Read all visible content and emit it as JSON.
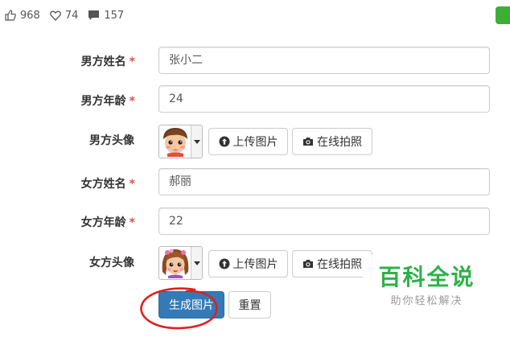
{
  "stats": {
    "likes": "968",
    "favorites": "74",
    "comments": "157"
  },
  "form": {
    "male_name": {
      "label": "男方姓名",
      "required_mark": "*",
      "value": "张小二"
    },
    "male_age": {
      "label": "男方年龄",
      "required_mark": "*",
      "value": "24"
    },
    "male_avatar": {
      "label": "男方头像",
      "upload_label": "上传图片",
      "photo_label": "在线拍照"
    },
    "female_name": {
      "label": "女方姓名",
      "required_mark": "*",
      "value": "郝丽"
    },
    "female_age": {
      "label": "女方年龄",
      "required_mark": "*",
      "value": "22"
    },
    "female_avatar": {
      "label": "女方头像",
      "upload_label": "上传图片",
      "photo_label": "在线拍照"
    },
    "generate_label": "生成图片",
    "reset_label": "重置"
  },
  "watermark": {
    "main": "百科全说",
    "sub": "助你轻松解决"
  },
  "colors": {
    "primary": "#337ab7",
    "required": "#d9534f",
    "annotation_circle": "#e02020",
    "watermark_green": "#2fb14a",
    "wechat_green": "#3cb034"
  }
}
